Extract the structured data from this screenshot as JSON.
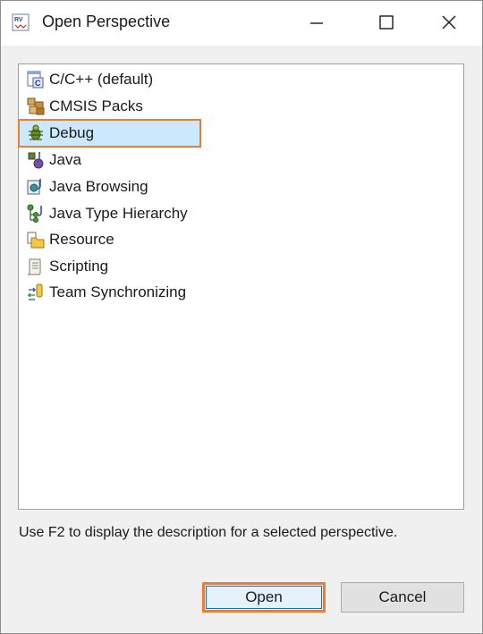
{
  "window": {
    "title": "Open Perspective",
    "app_icon": "rv-app-icon",
    "controls": [
      "minimize-icon",
      "maximize-icon",
      "close-icon"
    ]
  },
  "perspectives": [
    {
      "label": "C/C++ (default)",
      "icon": "c-cpp-perspective-icon",
      "selected": false
    },
    {
      "label": "CMSIS Packs",
      "icon": "cmsis-packs-icon",
      "selected": false
    },
    {
      "label": "Debug",
      "icon": "debug-bug-icon",
      "selected": true
    },
    {
      "label": "Java",
      "icon": "java-perspective-icon",
      "selected": false
    },
    {
      "label": "Java Browsing",
      "icon": "java-browsing-icon",
      "selected": false
    },
    {
      "label": "Java Type Hierarchy",
      "icon": "type-hierarchy-icon",
      "selected": false
    },
    {
      "label": "Resource",
      "icon": "resource-folder-icon",
      "selected": false
    },
    {
      "label": "Scripting",
      "icon": "scripting-icon",
      "selected": false
    },
    {
      "label": "Team Synchronizing",
      "icon": "team-sync-icon",
      "selected": false
    }
  ],
  "hint": "Use F2 to display the description for a selected perspective.",
  "buttons": {
    "open_label": "Open",
    "cancel_label": "Cancel"
  },
  "colors": {
    "highlight_border": "#ed7d31",
    "selection_bg": "#cce8ff"
  }
}
